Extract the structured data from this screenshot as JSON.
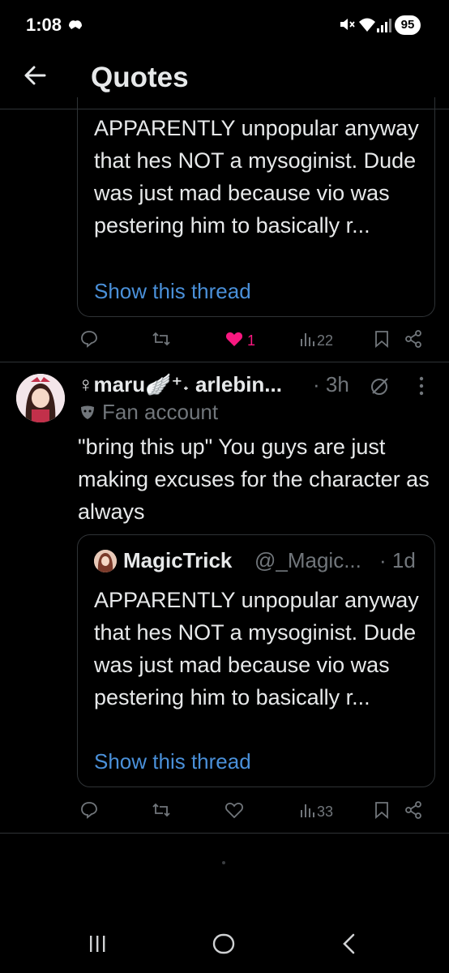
{
  "status_bar": {
    "time": "1:08",
    "battery": "95"
  },
  "header": {
    "title": "Quotes"
  },
  "top_post": {
    "text": "APPARENTLY unpopular anyway that hes NOT a mysoginist. Dude was just mad because vio was pestering him to basically r...",
    "thread_link": "Show this thread",
    "likes": "1",
    "views": "22"
  },
  "reply_post": {
    "display_name": "♀maru🪽⁺˖ arlebin...",
    "time": "· 3h",
    "badge": "Fan account",
    "text": "\"bring this up\" You guys are just making excuses for the character as always",
    "quote": {
      "author": "MagicTrick",
      "handle": "@_Magic...",
      "time": "· 1d",
      "text": "APPARENTLY unpopular anyway that hes NOT a mysoginist. Dude was just mad because vio was pestering him to basically r...",
      "thread_link": "Show this thread"
    },
    "views": "33"
  },
  "colors": {
    "background": "#000000",
    "link": "#4a90d9",
    "like_active": "#f91880",
    "muted": "#71767b"
  }
}
